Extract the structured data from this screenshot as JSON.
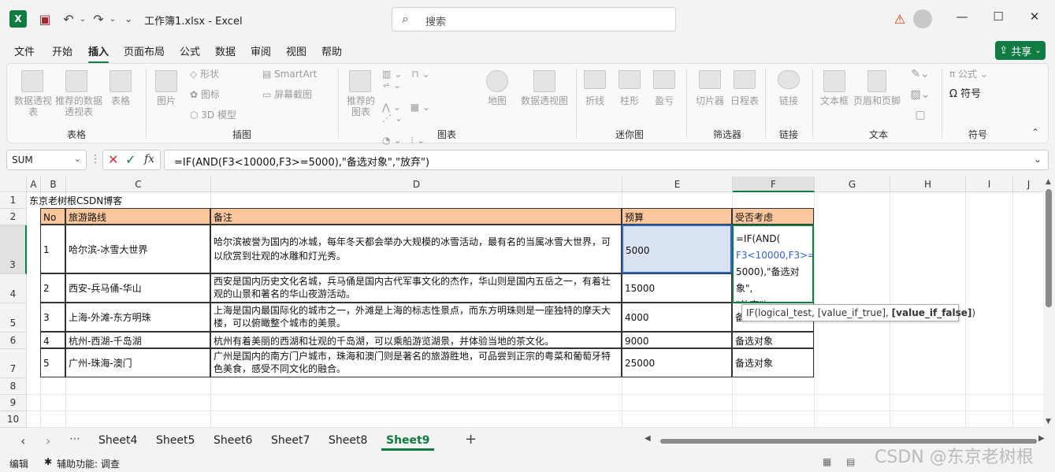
{
  "titlebar": {
    "doc_title": "工作簿1.xlsx  -  Excel",
    "search_placeholder": "搜索"
  },
  "menu": {
    "tabs": [
      "文件",
      "开始",
      "插入",
      "页面布局",
      "公式",
      "数据",
      "审阅",
      "视图",
      "帮助"
    ],
    "active": "插入",
    "share_label": "共享"
  },
  "ribbon": {
    "tables": {
      "pivot": "数据透视表",
      "recommended": "推荐的数据透视表",
      "table": "表格",
      "label": "表格"
    },
    "illustrations": {
      "picture": "图片",
      "shapes": "形状",
      "icons": "图标",
      "model3d": "3D 模型",
      "smartart": "SmartArt",
      "screenshot": "屏幕截图",
      "label": "插图"
    },
    "charts": {
      "recommended": "推荐的图表",
      "map": "地图",
      "pivotchart": "数据透视图",
      "label": "图表"
    },
    "sparklines": {
      "line": "折线",
      "column": "柱形",
      "winloss": "盈亏",
      "label": "迷你图"
    },
    "filters": {
      "slicer": "切片器",
      "timeline": "日程表",
      "label": "筛选器"
    },
    "links": {
      "link": "链接",
      "label": "链接"
    },
    "text": {
      "textbox": "文本框",
      "headerfooter": "页眉和页脚",
      "label": "文本"
    },
    "symbols": {
      "equation": "公式",
      "symbol": "符号",
      "label": "符号"
    }
  },
  "formula_bar": {
    "name_box": "SUM",
    "formula": "=IF(AND(F3<10000,F3>=5000),\"备选对象\",\"放弃\")"
  },
  "columns": [
    "A",
    "B",
    "C",
    "D",
    "E",
    "F",
    "G",
    "H",
    "I",
    "J",
    "K"
  ],
  "rows": [
    "1",
    "2",
    "3",
    "4",
    "5",
    "6",
    "7",
    "8",
    "9",
    "10"
  ],
  "sheet": {
    "a1": "东京老树根CSDN博客",
    "headers": {
      "no": "No",
      "route": "旅游路线",
      "note": "备注",
      "budget": "预算",
      "decision": "受否考虑"
    },
    "records": [
      {
        "no": "1",
        "route": "哈尔滨-冰雪大世界",
        "note": "哈尔滨被誉为国内的冰城，每年冬天都会举办大规模的冰雪活动，最有名的当属冰雪大世界，可以欣赏到壮观的冰雕和灯光秀。",
        "budget": "5000",
        "decision": ""
      },
      {
        "no": "2",
        "route": "西安-兵马俑-华山",
        "note": "西安是国内历史文化名城，兵马俑是国内古代军事文化的杰作，华山则是国内五岳之一，有着壮观的山景和著名的华山夜游活动。",
        "budget": "15000",
        "decision": ""
      },
      {
        "no": "3",
        "route": "上海-外滩-东方明珠",
        "note": "上海是国内最国际化的城市之一，外滩是上海的标志性景点，而东方明珠则是一座独特的摩天大楼，可以俯瞰整个城市的美景。",
        "budget": "4000",
        "decision": "备"
      },
      {
        "no": "4",
        "route": "杭州-西湖-千岛湖",
        "note": "杭州有着美丽的西湖和壮观的千岛湖，可以乘船游览湖景，并体验当地的茶文化。",
        "budget": "9000",
        "decision": "备选对象"
      },
      {
        "no": "5",
        "route": "广州-珠海-澳门",
        "note": "广州是国内的南方门户城市，珠海和澳门则是著名的旅游胜地，可品尝到正宗的粤菜和葡萄牙特色美食，感受不同文化的融合。",
        "budget": "25000",
        "decision": "备选对象"
      }
    ],
    "editing_formula_lines": [
      "=IF(AND(",
      "F3<10000,F3>=",
      "5000),\"备选对象\",",
      "\"放弃\")"
    ],
    "tooltip_prefix": "IF(logical_test, [value_if_true], ",
    "tooltip_bold": "[value_if_false]",
    "tooltip_suffix": ")"
  },
  "sheet_tabs": [
    "Sheet4",
    "Sheet5",
    "Sheet6",
    "Sheet7",
    "Sheet8",
    "Sheet9"
  ],
  "active_sheet": "Sheet9",
  "statusbar": {
    "mode": "编辑",
    "accessibility": "辅助功能: 调查"
  },
  "watermark": "CSDN @东京老树根",
  "accent_color": "#107c41",
  "header_fill": "#fcc79c"
}
